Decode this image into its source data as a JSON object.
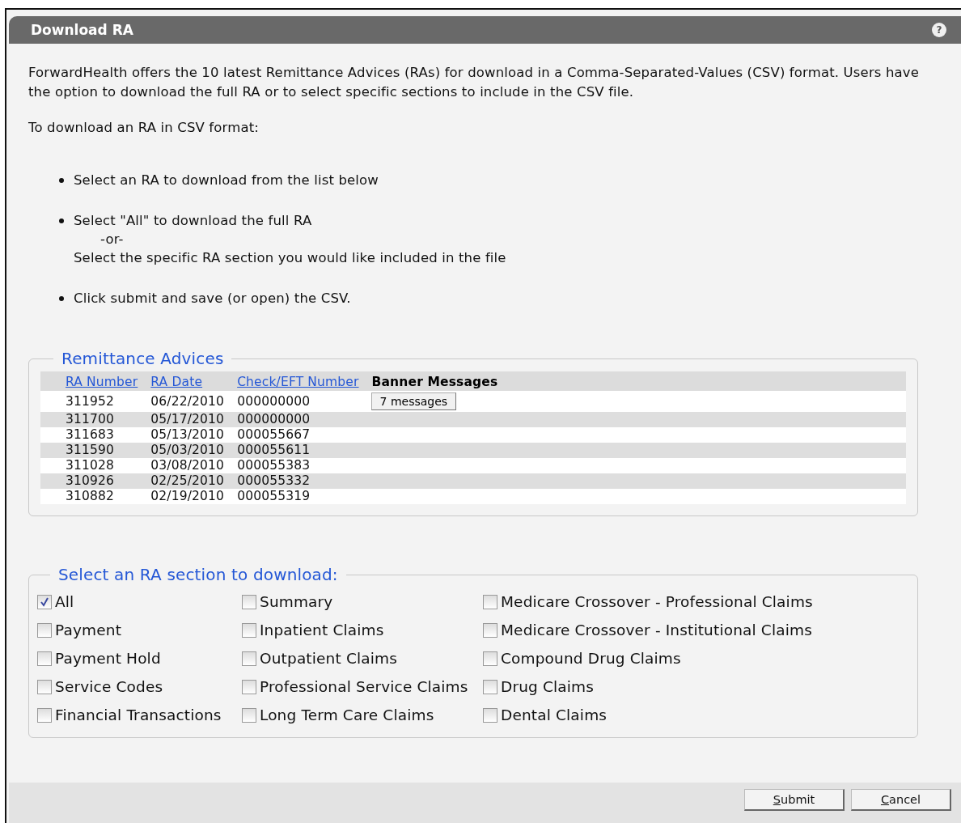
{
  "window": {
    "title": "Download RA",
    "help": "?"
  },
  "intro": "ForwardHealth offers the 10 latest Remittance Advices (RAs) for download in a Comma-Separated-Values (CSV) format. Users have the option to download the full RA or to select specific sections to include in the CSV file.",
  "steps_title": "To download an RA in CSV format:",
  "steps": [
    {
      "lines": [
        "Select an RA to download from the list below"
      ]
    },
    {
      "lines": [
        "Select \"All\" to download the full RA",
        "-or-",
        "Select the specific RA section you would like included in the file"
      ]
    },
    {
      "lines": [
        "Click submit and save (or open) the CSV."
      ]
    }
  ],
  "remittance": {
    "title": "Remittance Advices",
    "columns": [
      {
        "label": "RA Number",
        "sortable": true
      },
      {
        "label": "RA Date",
        "sortable": true
      },
      {
        "label": "Check/EFT Number",
        "sortable": true
      },
      {
        "label": "Banner Messages",
        "sortable": false
      }
    ],
    "rows": [
      {
        "cells": [
          "311952",
          "06/22/2010",
          "000000000"
        ],
        "banner_button": "7 messages"
      },
      {
        "cells": [
          "311700",
          "05/17/2010",
          "000000000"
        ]
      },
      {
        "cells": [
          "311683",
          "05/13/2010",
          "000055667"
        ]
      },
      {
        "cells": [
          "311590",
          "05/03/2010",
          "000055611"
        ]
      },
      {
        "cells": [
          "311028",
          "03/08/2010",
          "000055383"
        ]
      },
      {
        "cells": [
          "310926",
          "02/25/2010",
          "000055332"
        ]
      },
      {
        "cells": [
          "310882",
          "02/19/2010",
          "000055319"
        ]
      }
    ]
  },
  "sections": {
    "title": "Select an RA section to download:",
    "columns": [
      [
        {
          "label": "All",
          "checked": true
        },
        {
          "label": "Payment",
          "checked": false
        },
        {
          "label": "Payment Hold",
          "checked": false
        },
        {
          "label": "Service Codes",
          "checked": false
        },
        {
          "label": "Financial Transactions",
          "checked": false
        }
      ],
      [
        {
          "label": "Summary",
          "checked": false
        },
        {
          "label": "Inpatient Claims",
          "checked": false
        },
        {
          "label": "Outpatient Claims",
          "checked": false
        },
        {
          "label": "Professional Service Claims",
          "checked": false
        },
        {
          "label": "Long Term Care Claims",
          "checked": false
        }
      ],
      [
        {
          "label": "Medicare Crossover - Professional Claims",
          "checked": false
        },
        {
          "label": "Medicare Crossover - Institutional Claims",
          "checked": false
        },
        {
          "label": "Compound Drug Claims",
          "checked": false
        },
        {
          "label": "Drug Claims",
          "checked": false
        },
        {
          "label": "Dental Claims",
          "checked": false
        }
      ]
    ]
  },
  "buttons": [
    "Submit",
    "Cancel"
  ]
}
